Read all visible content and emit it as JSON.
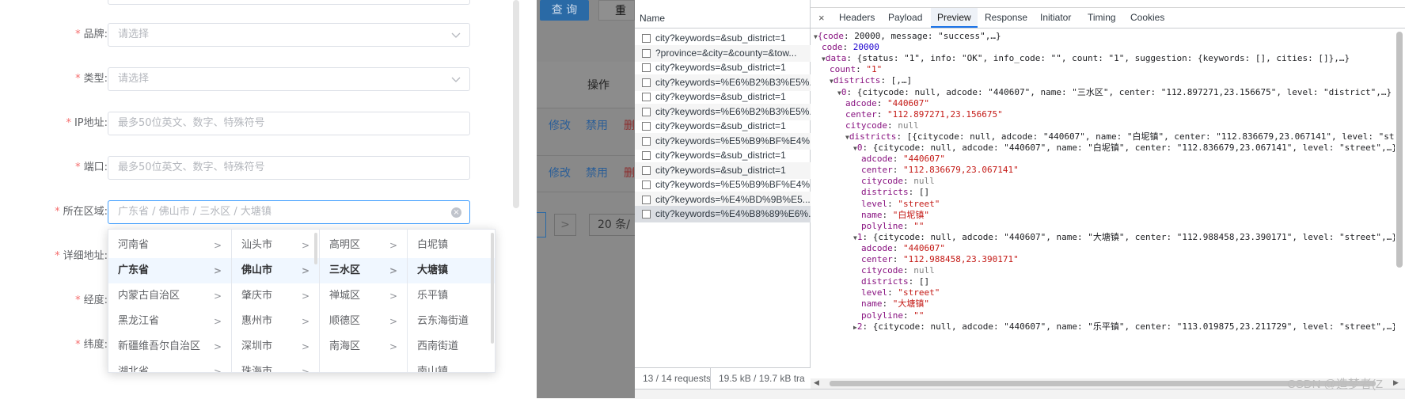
{
  "form": {
    "fields": [
      {
        "label": "品牌:",
        "placeholder": "请选择",
        "type": "select"
      },
      {
        "label": "类型:",
        "placeholder": "请选择",
        "type": "select"
      },
      {
        "label": "IP地址:",
        "placeholder": "最多50位英文、数字、特殊符号",
        "type": "input"
      },
      {
        "label": "端口:",
        "placeholder": "最多50位英文、数字、特殊符号",
        "type": "input"
      },
      {
        "label": "所在区域:",
        "placeholder": "广东省 / 佛山市 / 三水区 / 大塘镇",
        "type": "cascader"
      },
      {
        "label": "详细地址:"
      },
      {
        "label": "经度:"
      },
      {
        "label": "纬度:"
      }
    ],
    "required_mark": "*"
  },
  "cascader": {
    "columns": [
      {
        "items": [
          "河南省",
          "广东省",
          "内蒙古自治区",
          "黑龙江省",
          "新疆维吾尔自治区",
          "湖北省"
        ],
        "active": 1
      },
      {
        "items": [
          "汕头市",
          "佛山市",
          "肇庆市",
          "惠州市",
          "深圳市",
          "珠海市"
        ],
        "active": 1
      },
      {
        "items": [
          "高明区",
          "三水区",
          "禅城区",
          "顺德区",
          "南海区"
        ],
        "active": 1
      },
      {
        "items": [
          "白坭镇",
          "大塘镇",
          "乐平镇",
          "云东海街道",
          "西南街道",
          "南山镇"
        ],
        "active": 1
      }
    ]
  },
  "background_page": {
    "query_button": "查 询",
    "reset_button": "重",
    "ops_header": "操作",
    "rows": [
      {
        "edit": "修改",
        "disable": "禁用",
        "del": "删"
      },
      {
        "edit": "修改",
        "disable": "禁用",
        "del": "删"
      }
    ],
    "pager_next": ">",
    "page_size": "20 条/"
  },
  "devtools": {
    "name_header": "Name",
    "requests": [
      "city?keywords=&sub_district=1",
      "?province=&city=&county=&tow...",
      "city?keywords=&sub_district=1",
      "city?keywords=%E6%B2%B3%E5%...",
      "city?keywords=&sub_district=1",
      "city?keywords=%E6%B2%B3%E5%...",
      "city?keywords=&sub_district=1",
      "city?keywords=%E5%B9%BF%E4%...",
      "city?keywords=&sub_district=1",
      "city?keywords=&sub_district=1",
      "city?keywords=%E5%B9%BF%E4%...",
      "city?keywords=%E4%BD%9B%E5...",
      "city?keywords=%E4%B8%89%E6%..."
    ],
    "selected_request": 12,
    "status_requests": "13 / 14 requests",
    "status_size": "19.5 kB / 19.7 kB tra",
    "close": "×",
    "tabs": [
      "Headers",
      "Payload",
      "Preview",
      "Response",
      "Initiator",
      "Timing",
      "Cookies"
    ],
    "active_tab": "Preview",
    "preview_lines": [
      "▼{code: 20000, message: \"success\",…}",
      "code: 20000",
      "▼data: {status: \"1\", info: \"OK\", info_code: \"\", count: \"1\", suggestion: {keywords: [], cities: []},…}",
      "count: \"1\"",
      "▼districts: [,…]",
      "▼0: {citycode: null, adcode: \"440607\", name: \"三水区\", center: \"112.897271,23.156675\", level: \"district\",…}",
      "adcode: \"440607\"",
      "center: \"112.897271,23.156675\"",
      "citycode: null",
      "▼districts: [{citycode: null, adcode: \"440607\", name: \"白坭镇\", center: \"112.836679,23.067141\", level: \"street\",…},…]",
      "▼0: {citycode: null, adcode: \"440607\", name: \"白坭镇\", center: \"112.836679,23.067141\", level: \"street\",…}",
      "adcode: \"440607\"",
      "center: \"112.836679,23.067141\"",
      "citycode: null",
      "districts: []",
      "level: \"street\"",
      "name: \"白坭镇\"",
      "polyline: \"\"",
      "▼1: {citycode: null, adcode: \"440607\", name: \"大塘镇\", center: \"112.988458,23.390171\", level: \"street\",…}",
      "adcode: \"440607\"",
      "center: \"112.988458,23.390171\"",
      "citycode: null",
      "districts: []",
      "level: \"street\"",
      "name: \"大塘镇\"",
      "polyline: \"\"",
      "▶2: {citycode: null, adcode: \"440607\", name: \"乐平镇\", center: \"113.019875,23.211729\", level: \"street\",…}"
    ],
    "watermark": "CSDN @造梦者(Z"
  }
}
